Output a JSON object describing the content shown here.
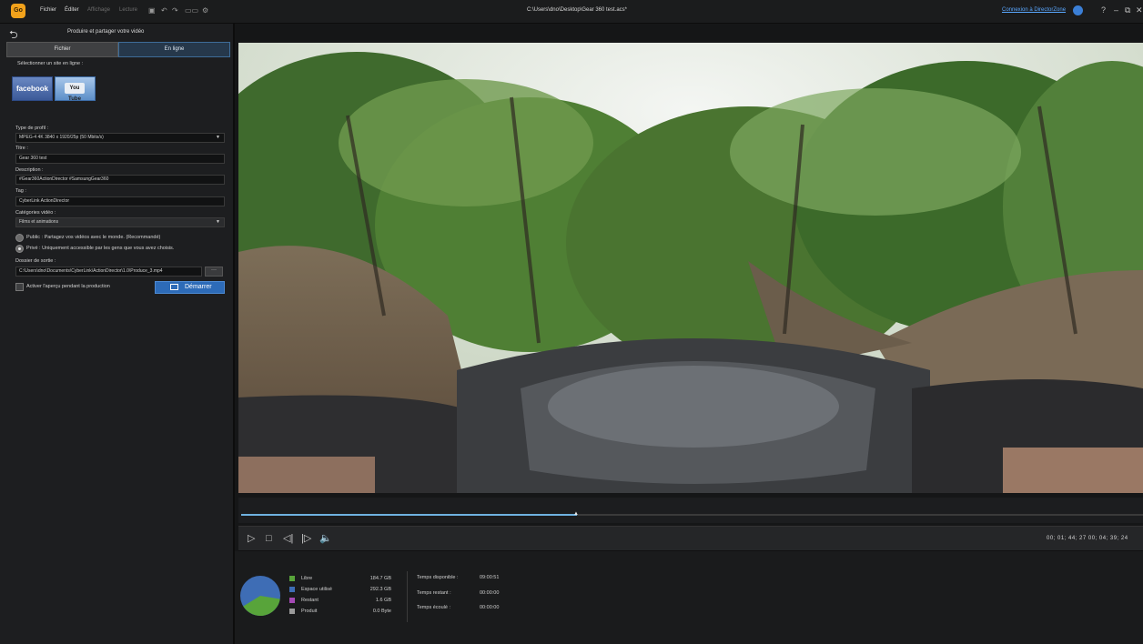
{
  "app": {
    "logo_text": "Go",
    "menu": [
      {
        "label": "Fichier",
        "enabled": true
      },
      {
        "label": "Éditer",
        "enabled": true
      },
      {
        "label": "Affichage",
        "enabled": false
      },
      {
        "label": "Lecture",
        "enabled": false
      }
    ],
    "window_title": "C:\\Users\\dno\\Desktop\\Gear 360 test.acs*",
    "directorzone_link": "Connexion à DirectorZone",
    "help": "?",
    "minimize": "–",
    "maximize": "⧉",
    "close": "✕"
  },
  "produce": {
    "back_icon": "⮌",
    "title": "Produire et partager votre vidéo",
    "tabs": [
      "Fichier",
      "En ligne"
    ],
    "active_tab": "En ligne",
    "site_label": "Sélectionner un site en ligne :",
    "sites": {
      "facebook": "facebook",
      "youtube": "You Tube"
    },
    "profile_type_label": "Type de profil :",
    "profile_type": "MPEG-4 4K 3840 x 1920/25p (50 Mbits/s)",
    "title_label": "Titre :",
    "title_value": "Gear 360 test",
    "description_label": "Description :",
    "description_value": "#Gear360ActionDirector #SamsungGear360",
    "tag_label": "Tag :",
    "tag_value": "CyberLink ActionDirector",
    "category_label": "Catégories vidéo :",
    "category_value": "Films et animations",
    "privacy_public": "Public : Partagez vos vidéos avec le monde. (Recommandé)",
    "privacy_private": "Privé : Uniquement accessible par les gens que vous avez choisis.",
    "privacy_selected": "private",
    "output_label": "Dossier de sortie :",
    "output_path": "C:\\Users\\dno\\Documents\\CyberLink\\ActionDirector\\1.0\\Produce_3.mp4",
    "browse": "···",
    "preview_label": "Activer l'aperçu pendant la production",
    "preview_checked": false,
    "start_button": "Démarrer"
  },
  "player": {
    "progress": 0.372,
    "timecode": "00; 01; 44; 27  00; 04; 39; 24"
  },
  "disk": {
    "legend": [
      {
        "label": "Libre",
        "value": "184.7  GB",
        "color": "#58a43a"
      },
      {
        "label": "Espace utilisé",
        "value": "292.3  GB",
        "color": "#3e6db5"
      },
      {
        "label": "Restant",
        "value": "1.6  GB",
        "color": "#a449b5"
      },
      {
        "label": "Produit",
        "value": "0.0  Byte",
        "color": "#9a9a9a"
      }
    ],
    "pie_fractions": {
      "free": 0.387,
      "used": 0.613
    }
  },
  "times": [
    {
      "label": "Temps disponible :",
      "value": "09:00:51"
    },
    {
      "label": "Temps restant :",
      "value": "00:00:00"
    },
    {
      "label": "Temps écoulé :",
      "value": "00:00:00"
    }
  ]
}
